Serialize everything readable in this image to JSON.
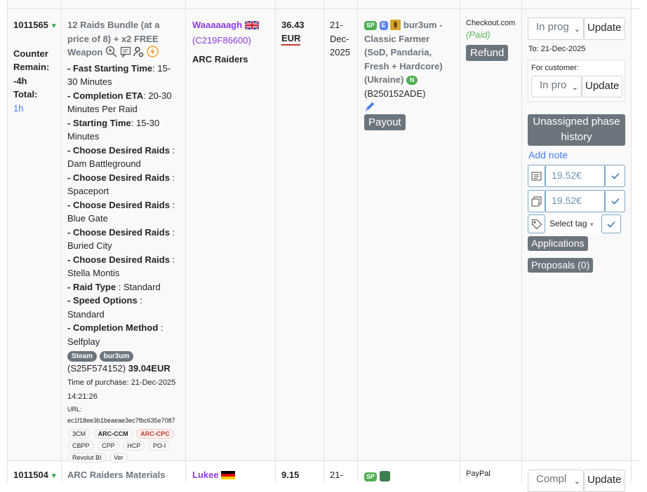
{
  "row1": {
    "order_id": "1011565",
    "counter_label": "Counter",
    "remain_label": "Remain:",
    "remain_value": "-4h",
    "total_label": "Total:",
    "total_value": "1h",
    "product_title_lines": [
      "12 Raids Bundle (at a",
      "price of 8) + x2 FREE",
      "Weapon"
    ],
    "options": [
      {
        "label": "- Fast Starting Time",
        "sep": ": ",
        "value_lines": [
          "15-",
          "30 Minutes"
        ]
      },
      {
        "label": "- Completion ETA",
        "sep": ": ",
        "value_lines": [
          "20-30",
          "Minutes Per Raid"
        ]
      },
      {
        "label": "- Starting Time",
        "sep": ": ",
        "value_lines": [
          "15-30",
          "Minutes"
        ]
      },
      {
        "label": "- Choose Desired Raids",
        "sep": " :",
        "value_lines": [
          "",
          "Dam Battleground"
        ]
      },
      {
        "label": "- Choose Desired Raids",
        "sep": " :",
        "value_lines": [
          "",
          "Spaceport"
        ]
      },
      {
        "label": "- Choose Desired Raids",
        "sep": " :",
        "value_lines": [
          "",
          "Blue Gate"
        ]
      },
      {
        "label": "- Choose Desired Raids",
        "sep": " :",
        "value_lines": [
          "",
          "Buried City"
        ]
      },
      {
        "label": "- Choose Desired Raids",
        "sep": " :",
        "value_lines": [
          "",
          "Stella Montis"
        ]
      },
      {
        "label": "- Raid Type",
        "sep": " : ",
        "value_lines": [
          "Standard"
        ]
      },
      {
        "label": "- Speed Options",
        "sep": " :",
        "value_lines": [
          "",
          "Standard"
        ]
      },
      {
        "label": "- Completion Method",
        "sep": " :",
        "value_lines": [
          "",
          "Selfplay"
        ]
      }
    ],
    "tags": [
      "Steam",
      "bur3um"
    ],
    "sub_id": "(S25F574152)",
    "sub_price": "39.04EUR",
    "purchase_label": "Time of purchase:",
    "purchase_date": "21-Dec-2025",
    "purchase_time": "14:21:26",
    "url_label": "URL:",
    "url_value": "ec1f18ee3b1beaeae3ec7fbc635e7087",
    "pills_row1": [
      "3CM",
      "ARC-CCM",
      "ARC-CPC"
    ],
    "pills_row2": [
      "CBPP",
      "CPP",
      "HCP",
      "PO-I"
    ],
    "pills_row3": [
      "Revolut BI",
      "Ver"
    ],
    "customer_name": "Waaaaaagh",
    "customer_id": "(C219F86600)",
    "game": "ARC Raiders",
    "price_amount": "36.43",
    "price_currency": "EUR",
    "date_parts": [
      "21-",
      "Dec-",
      "2025"
    ],
    "booster_badges": [
      "SP",
      "E"
    ],
    "booster_name": "bur3um -",
    "booster_lines": [
      "Classic Farmer",
      "(SoD, Pandaria,",
      "Fresh + Hardcore)",
      "(Ukraine)"
    ],
    "booster_new_badge": "N",
    "booster_id": "(B250152ADE)",
    "payout_label": "Payout",
    "payment_method": "Checkout.com",
    "payment_status": "(Paid)",
    "refund_label": "Refund",
    "status_select": "In prog",
    "update_label": "Update",
    "to_date": "To: 21-Dec-2025",
    "for_customer_label": "For customer:",
    "customer_status_select": "In pro",
    "customer_update_label": "Update",
    "unassigned_label_1": "Unassigned phase",
    "unassigned_label_2": "history",
    "add_note_label": "Add note",
    "amount1": "19.52€",
    "amount2": "19.52€",
    "tag_select": "Select tag",
    "applications_label": "Applications",
    "proposals_label": "Proposals (0)"
  },
  "row2": {
    "order_id": "1011504",
    "product_title": "ARC Raiders Materials",
    "customer_name": "Lukee",
    "price_amount": "9.15",
    "date_part": "21-",
    "booster_badge": "SP",
    "payment_method": "PayPal",
    "status_select": "Compl",
    "update_label": "Update"
  },
  "colors": {
    "purple": "#8b3de0",
    "blue_link": "#4a7fe8",
    "grey_button": "#6c757d",
    "green_badge": "#4caf50",
    "blue_badge": "#5b7ff0",
    "paid_green": "#5cb85c",
    "pill_red": "#c0392b"
  }
}
